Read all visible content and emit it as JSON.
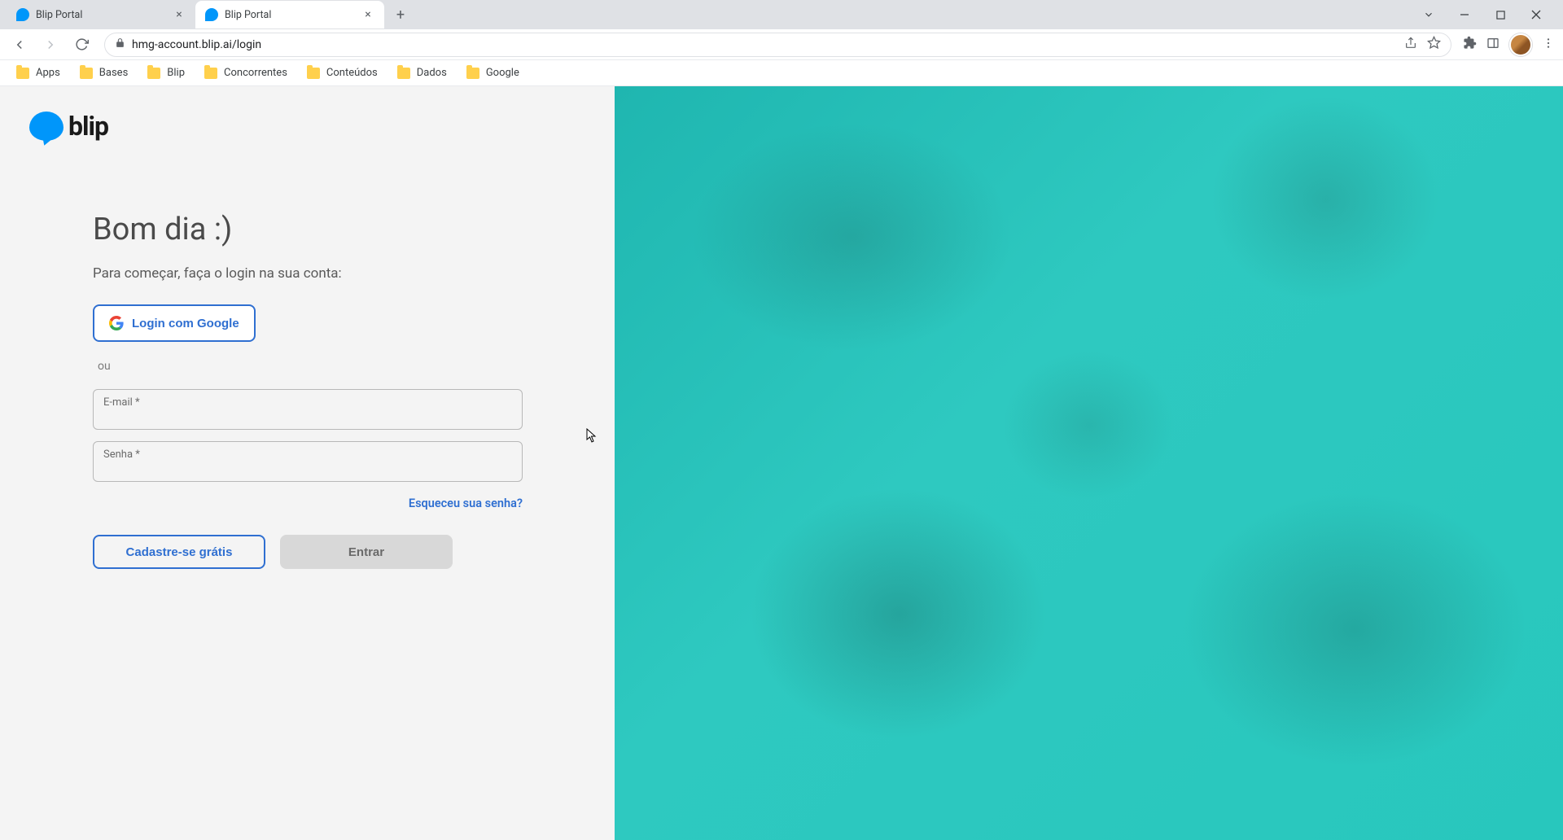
{
  "browser": {
    "tabs": [
      {
        "title": "Blip Portal",
        "active": false
      },
      {
        "title": "Blip Portal",
        "active": true
      }
    ],
    "url": "hmg-account.blip.ai/login",
    "bookmarks": [
      "Apps",
      "Bases",
      "Blip",
      "Concorrentes",
      "Conteúdos",
      "Dados",
      "Google"
    ]
  },
  "page": {
    "logo_text": "blip",
    "greeting": "Bom dia :)",
    "subtitle": "Para começar, faça o login na sua conta:",
    "google_login_label": "Login com Google",
    "or_label": "ou",
    "email_label": "E-mail *",
    "password_label": "Senha *",
    "forgot_label": "Esqueceu sua senha?",
    "signup_label": "Cadastre-se grátis",
    "enter_label": "Entrar"
  },
  "colors": {
    "accent_blue": "#2f6fd1",
    "brand_blue": "#0096fa",
    "right_teal": "#21c4bb"
  }
}
